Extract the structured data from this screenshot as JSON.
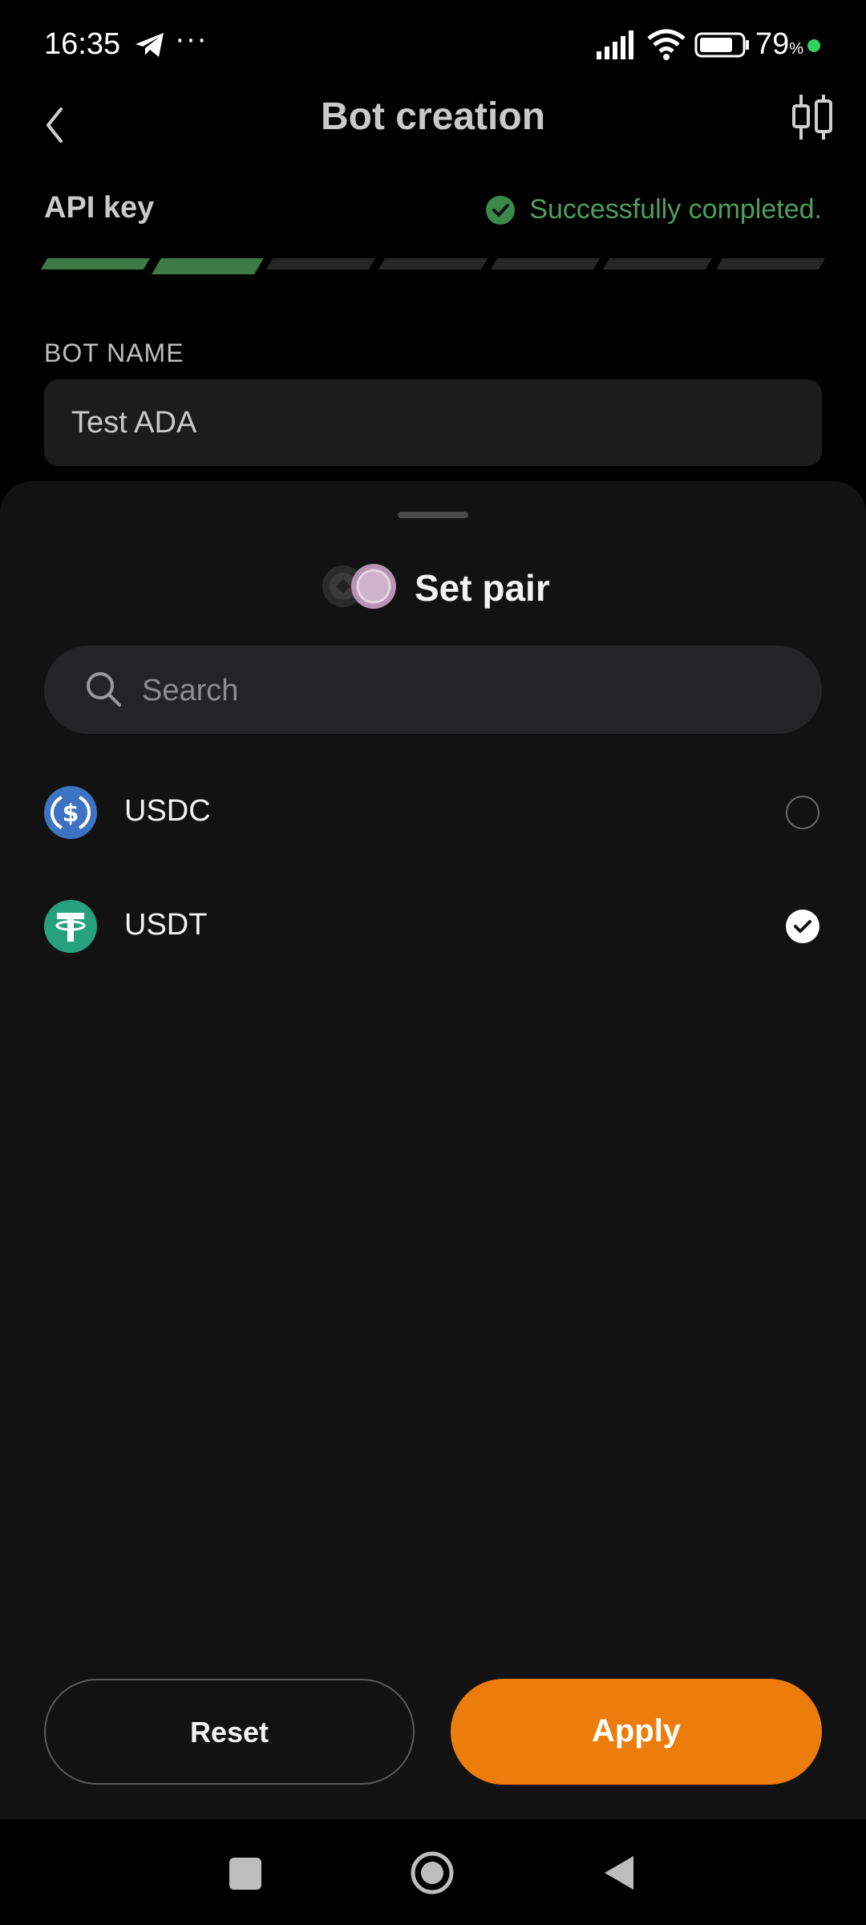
{
  "status_bar": {
    "time": "16:35",
    "dots": "···",
    "battery_value": "79",
    "battery_unit": "%",
    "icons": [
      "telegram-icon",
      "more-icon",
      "signal-icon",
      "wifi-icon",
      "battery-icon",
      "status-dot"
    ],
    "dot_color": "#2fd15a"
  },
  "header": {
    "title": "Bot creation",
    "back_icon": "chevron-left-icon",
    "action_icon": "candlestick-chart-icon"
  },
  "steps": {
    "label": "API key",
    "status": "Successfully completed.",
    "status_color": "#4f9f5b",
    "total": 7,
    "current": 2
  },
  "bot_name": {
    "label": "BOT NAME",
    "value": "Test ADA"
  },
  "sheet": {
    "title": "Set pair",
    "search_placeholder": "Search",
    "items": [
      {
        "label": "USDC",
        "icon": "usdc-coin-icon",
        "color": "#3e73c4",
        "selected": false
      },
      {
        "label": "USDT",
        "icon": "usdt-coin-icon",
        "color": "#26a17b",
        "selected": true
      }
    ],
    "reset_label": "Reset",
    "apply_label": "Apply",
    "accent": "#ec7d0c"
  },
  "nav_bar": {
    "icons": [
      "recents-icon",
      "home-icon",
      "back-icon"
    ]
  }
}
